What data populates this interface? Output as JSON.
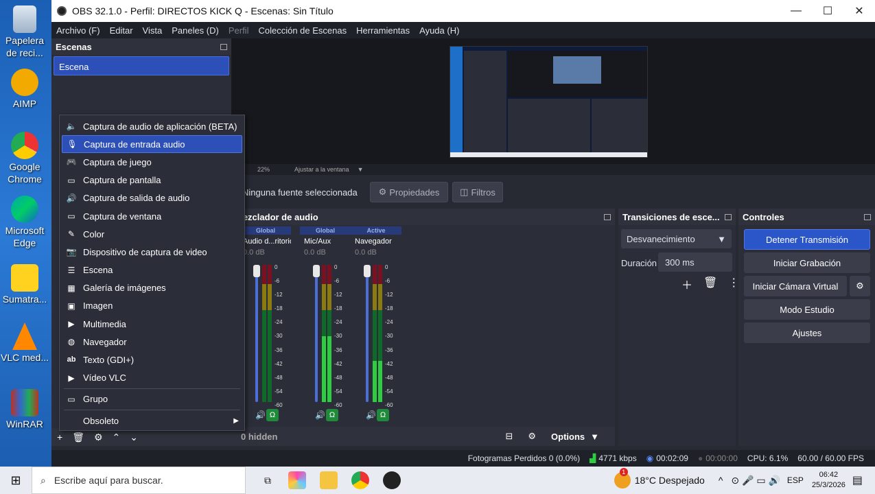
{
  "desktop": {
    "icons": [
      {
        "label": "Papelera de reci...",
        "icon": "recycle-bin-icon"
      },
      {
        "label": "AIMP",
        "icon": "aimp-icon"
      },
      {
        "label": "Google Chrome",
        "icon": "chrome-icon"
      },
      {
        "label": "Microsoft Edge",
        "icon": "edge-icon"
      },
      {
        "label": "Sumatra...",
        "icon": "sumatra-pdf-icon"
      },
      {
        "label": "VLC med...",
        "icon": "vlc-icon"
      },
      {
        "label": "WinRAR",
        "icon": "winrar-icon"
      }
    ]
  },
  "window": {
    "title": "OBS 32.1.0 - Perfil: DIRECTOS KICK Q - Escenas: Sin Título",
    "min": "—",
    "max": "☐",
    "close": "✕"
  },
  "menubar": [
    "Archivo (F)",
    "Editar",
    "Vista",
    "Paneles (D)",
    "Perfil",
    "Colección de Escenas",
    "Herramientas",
    "Ayuda (H)"
  ],
  "scenes": {
    "title": "Escenas",
    "items": [
      "Escena"
    ]
  },
  "preview": {
    "zoom": "22%",
    "fit": "Ajustar a la ventana"
  },
  "sources_bar": {
    "no_source": "Ninguna fuente seleccionada",
    "properties": "Propiedades",
    "filters": "Filtros"
  },
  "mixer": {
    "title": "Mezclador de audio",
    "channels": [
      {
        "tag": "Global",
        "name": "Audio d...ritorio",
        "db": "0.0 dB"
      },
      {
        "tag": "Global",
        "name": "Mic/Aux",
        "db": "0.0 dB"
      },
      {
        "tag": "Active",
        "name": "Navegador",
        "db": "0.0 dB"
      }
    ],
    "scale": [
      "0",
      "-6",
      "-12",
      "-18",
      "-24",
      "-30",
      "-36",
      "-42",
      "-48",
      "-54",
      "-60"
    ],
    "hidden": "0 hidden",
    "options": "Options"
  },
  "transitions": {
    "title": "Transiciones de esce...",
    "selected": "Desvanecimiento",
    "duration_label": "Duración",
    "duration": "300 ms"
  },
  "controls": {
    "title": "Controles",
    "buttons": [
      "Detener Transmisión",
      "Iniciar Grabación",
      "Iniciar Cámara Virtual",
      "Modo Estudio",
      "Ajustes"
    ]
  },
  "status": {
    "dropped": "Fotogramas Perdidos 0 (0.0%)",
    "kbps": "4771 kbps",
    "stream_time": "00:02:09",
    "rec_time": "00:00:00",
    "cpu": "CPU: 6.1%",
    "fps": "60.00 / 60.00 FPS"
  },
  "context_menu": {
    "items": [
      {
        "label": "Captura de audio de aplicación (BETA)",
        "icon": "speaker-icon",
        "glyph": "🔈"
      },
      {
        "label": "Captura de entrada audio",
        "icon": "microphone-icon",
        "glyph": "🎙"
      },
      {
        "label": "Captura de juego",
        "icon": "gamepad-icon",
        "glyph": "🎮"
      },
      {
        "label": "Captura de pantalla",
        "icon": "monitor-icon",
        "glyph": "▭"
      },
      {
        "label": "Captura de salida de audio",
        "icon": "speaker-out-icon",
        "glyph": "🔊"
      },
      {
        "label": "Captura de ventana",
        "icon": "window-icon",
        "glyph": "▭"
      },
      {
        "label": "Color",
        "icon": "brush-icon",
        "glyph": "✎"
      },
      {
        "label": "Dispositivo de captura de video",
        "icon": "camera-icon",
        "glyph": "📷"
      },
      {
        "label": "Escena",
        "icon": "list-icon",
        "glyph": "☰"
      },
      {
        "label": "Galería de imágenes",
        "icon": "gallery-icon",
        "glyph": "▦"
      },
      {
        "label": "Imagen",
        "icon": "image-icon",
        "glyph": "▣"
      },
      {
        "label": "Multimedia",
        "icon": "play-icon",
        "glyph": "▶"
      },
      {
        "label": "Navegador",
        "icon": "globe-icon",
        "glyph": "◍"
      },
      {
        "label": "Texto (GDI+)",
        "icon": "text-icon",
        "glyph": "ab"
      },
      {
        "label": "Vídeo VLC",
        "icon": "play-icon",
        "glyph": "▶"
      }
    ],
    "group": {
      "label": "Grupo",
      "icon": "folder-icon",
      "glyph": "▭"
    },
    "obsolete": {
      "label": "Obsoleto",
      "arrow": "▶"
    }
  },
  "taskbar": {
    "search_placeholder": "Escribe aquí para buscar.",
    "weather": "18°C  Despejado",
    "lang": "ESP",
    "time": "06:42",
    "date": "25/3/2026",
    "notif_count": "1"
  }
}
